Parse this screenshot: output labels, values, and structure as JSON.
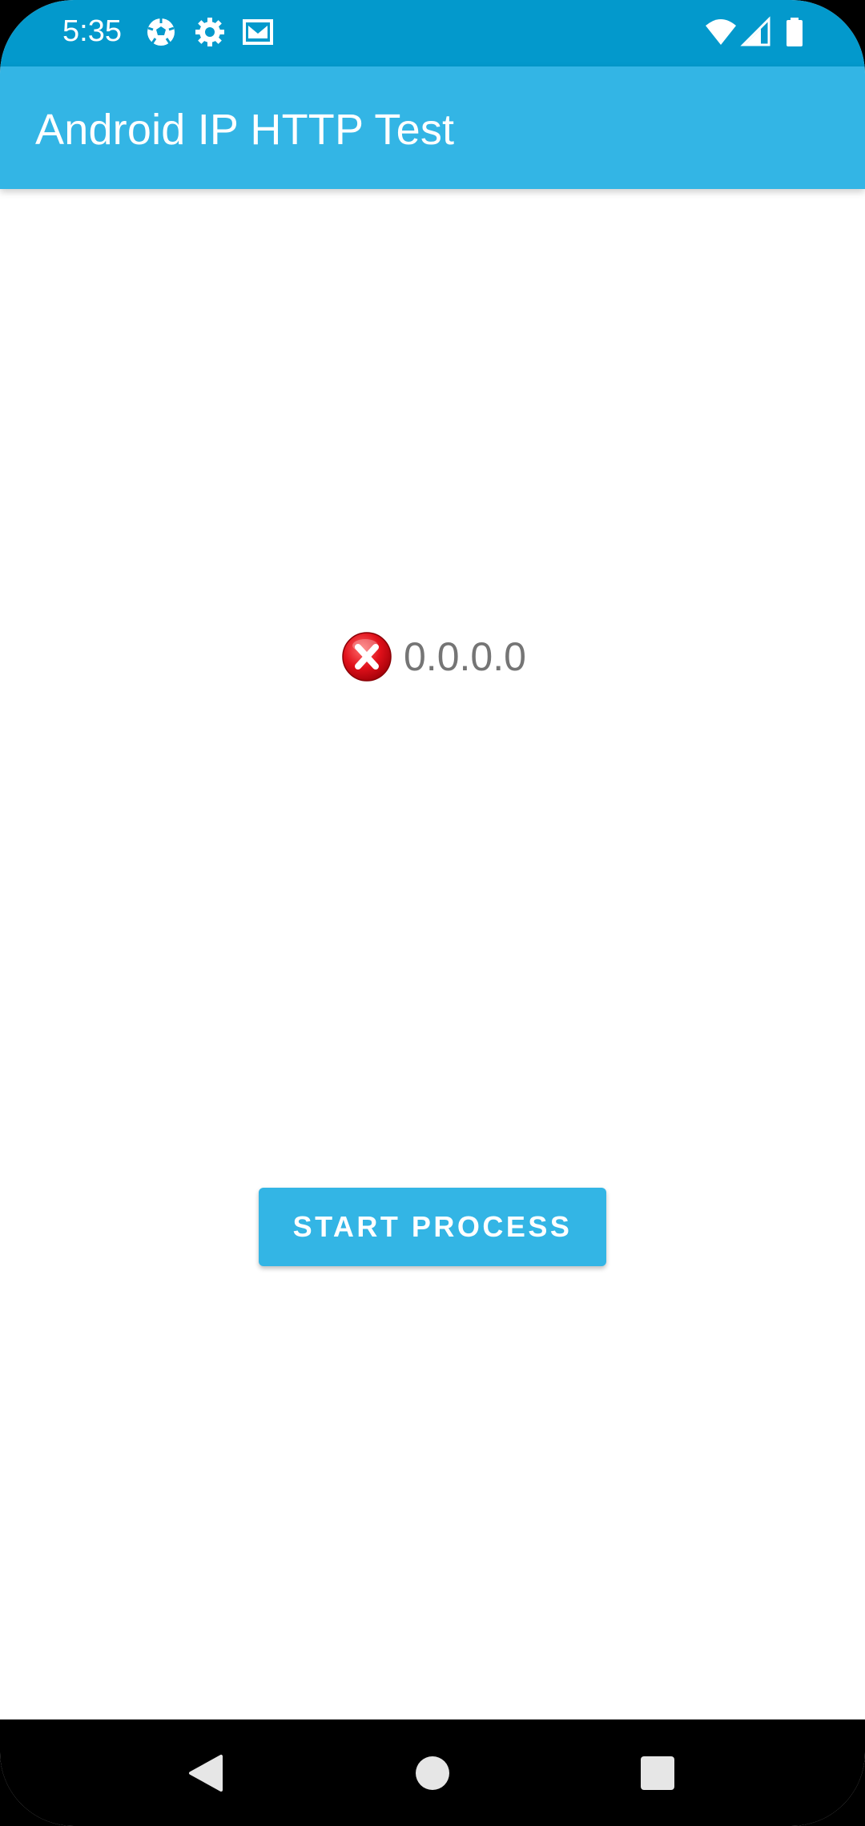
{
  "status_bar": {
    "time": "5:35",
    "left_icons": [
      "soccer-ball-icon",
      "settings-icon",
      "gmail-icon"
    ],
    "right_icons": [
      "wifi-icon",
      "cellular-signal-icon",
      "battery-icon"
    ],
    "background_color": "#0399cc"
  },
  "app_bar": {
    "title": "Android IP HTTP Test",
    "background_color": "#33b5e5"
  },
  "main": {
    "ip_status_icon": "error-x-icon",
    "ip_address": "0.0.0.0",
    "start_button_label": "START PROCESS",
    "accent_color": "#33b5e5"
  },
  "nav_bar": {
    "buttons": [
      "back-icon",
      "home-icon",
      "recents-icon"
    ]
  }
}
